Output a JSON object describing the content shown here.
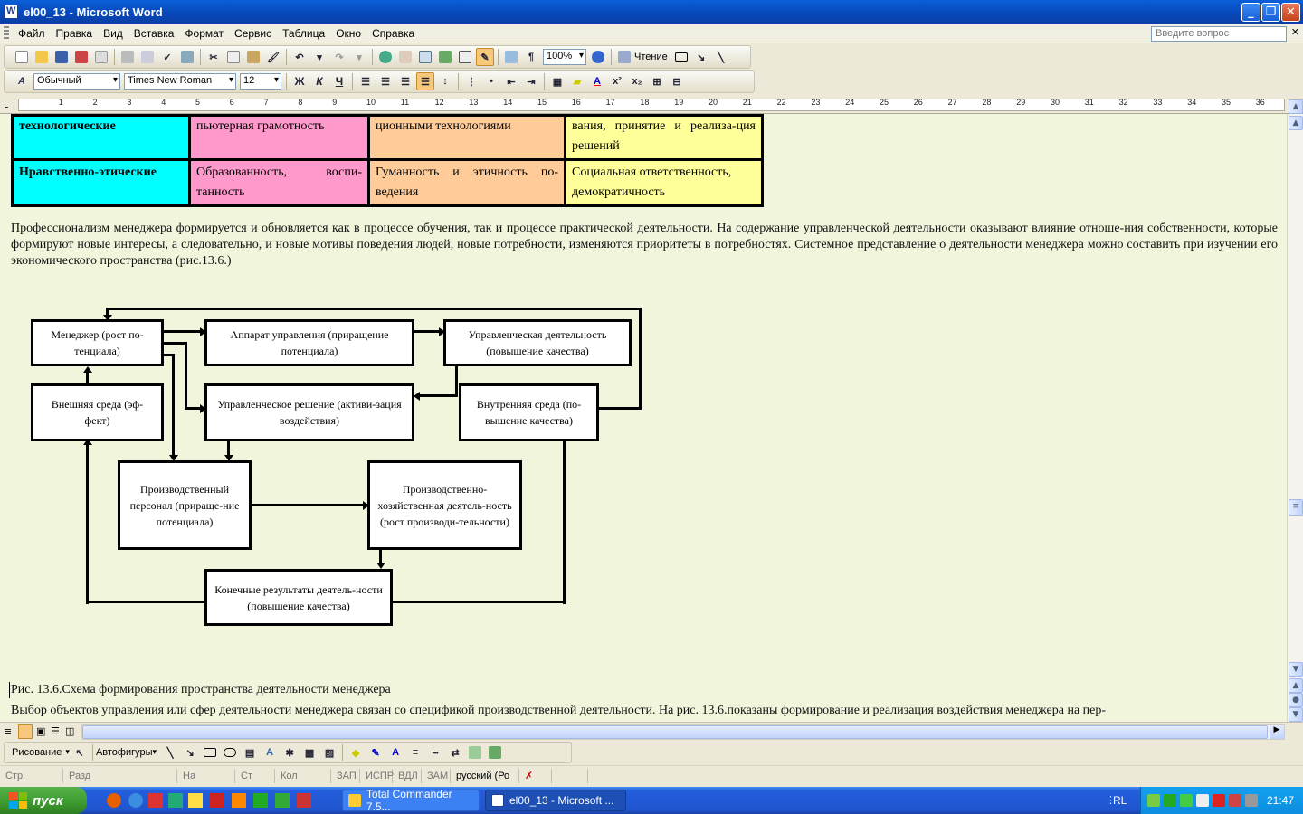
{
  "window": {
    "title": "el00_13 - Microsoft Word"
  },
  "menu": {
    "items": [
      "Файл",
      "Правка",
      "Вид",
      "Вставка",
      "Формат",
      "Сервис",
      "Таблица",
      "Окно",
      "Справка"
    ],
    "help_placeholder": "Введите вопрос"
  },
  "toolbar": {
    "zoom": "100%",
    "read_label": "Чтение",
    "style": "Обычный",
    "font": "Times New Roman",
    "size": "12",
    "bold": "Ж",
    "italic": "К",
    "underline": "Ч"
  },
  "ruler": {
    "numbers": [
      "1",
      "2",
      "3",
      "4",
      "5",
      "6",
      "7",
      "8",
      "9",
      "10",
      "11",
      "12",
      "13",
      "14",
      "15",
      "16",
      "17",
      "18",
      "19",
      "20",
      "21",
      "22",
      "23",
      "24",
      "25",
      "26",
      "27",
      "28",
      "29",
      "30",
      "31",
      "32",
      "33",
      "34",
      "35",
      "36"
    ]
  },
  "table": {
    "rows": [
      [
        "технологические",
        "пьютерная грамотность",
        "ционными технологиями",
        "вания, принятие и реализа-ция решений"
      ],
      [
        "Нравственно-этические",
        "Образованность, воспи-танность",
        "Гуманность и этичность по-ведения",
        "Социальная ответственность, демократичность"
      ]
    ],
    "colors": [
      "#00ffff",
      "#ff99cc",
      "#ffcc99",
      "#ffff99"
    ]
  },
  "document": {
    "paragraph1": "Профессионализм менеджера формируется и обновляется как в процессе обучения, так и процессе практической деятельности. На содержание управленческой деятельности оказывают влияние отноше-ния собственности, которые формируют новые интересы, а следовательно, и новые мотивы поведения людей, новые потребности, изменяются приоритеты в потребностях. Системное представление о деятельности менеджера можно составить при изучении его экономического пространства (рис.13.6.)",
    "caption": "Рис. 13.6.Схема формирования пространства деятельности менеджера",
    "paragraph2": "Выбор объектов управления или сфер деятельности менеджера связан со спецификой производственной деятельности. На рис. 13.6.показаны формирование и реализация воздействия менеджера на пер-"
  },
  "diagram": {
    "manager": "Менеджер (рост по-тенциала)",
    "apparatus": "Аппарат управления (приращение потенциала)",
    "activity": "Управленческая деятельность (повышение качества)",
    "external": "Внешняя среда (эф-фект)",
    "decision": "Управленческое решение (активи-зация воздействия)",
    "internal": "Внутренняя среда (по-вышение качества)",
    "staff": "Производственный персонал (прираще-ние потенциала)",
    "production": "Производственно-хозяйственная деятель-ность (рост производи-тельности)",
    "results": "Конечные результаты деятель-ности (повышение качества)"
  },
  "drawing_toolbar": {
    "draw": "Рисование",
    "autoshapes": "Автофигуры"
  },
  "status": {
    "page": "Стр.",
    "section": "Разд",
    "at": "На",
    "line": "Ст",
    "col": "Кол",
    "rec": "ЗАП",
    "trk": "ИСПР",
    "ext": "ВДЛ",
    "ovr": "ЗАМ",
    "lang": "русский (Ро"
  },
  "taskbar": {
    "start": "пуск",
    "tasks": [
      "Total Commander 7.5...",
      "el00_13 - Microsoft ..."
    ],
    "lang": "RL",
    "clock": "21:47"
  }
}
